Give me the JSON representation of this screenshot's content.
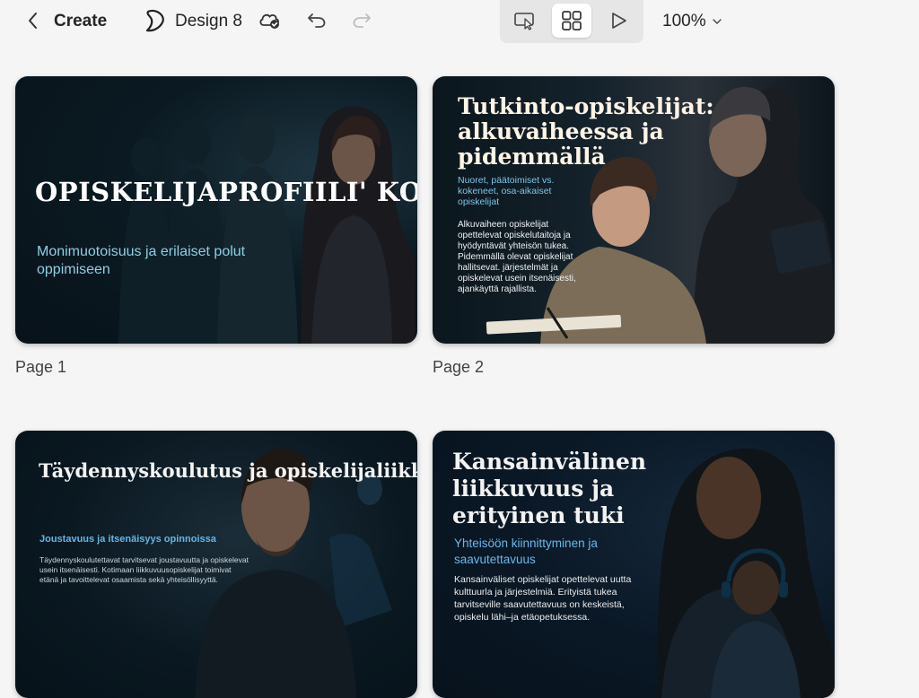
{
  "toolbar": {
    "create_label": "Create",
    "design_name": "Design 8",
    "zoom_label": "100%"
  },
  "icons": {
    "back": "chevron-left-icon",
    "logo": "design-logo-icon",
    "cloud": "cloud-saved-icon",
    "undo": "undo-icon",
    "redo": "redo-icon",
    "present_cursor": "cursor-present-icon",
    "grid": "grid-view-icon",
    "play": "play-icon",
    "zoom_chevron": "chevron-down-icon"
  },
  "colors": {
    "accent_blue": "#7fc4ea",
    "card_dark": "#0b1a22"
  },
  "pages": [
    {
      "label": "Page 1",
      "title": "OPISKELIJAPROFIILI' KORKEAKOULUISSA",
      "subtitle": "Monimuotoisuus ja erilaiset polut oppimiseen",
      "body": ""
    },
    {
      "label": "Page 2",
      "title": "Tutkinto-opiskelijat: alkuvaiheessa ja pidemmällä",
      "subtitle": "Nuoret, päätoimiset vs. kokeneet, osa-aikaiset opiskelijat",
      "body": "Alkuvaiheen opiskelijat opettelevat opiskelutaitoja ja hyödyntävät yhteisön tukea. Pidemmällä olevat opiskelijat hallitsevat. järjestelmät ja opiskelevat usein itsenäisesti, ajankäyttä rajallista."
    },
    {
      "label": "",
      "title": "Täydennyskoulutus ja opiskelijaliikkuvuus Suomessa",
      "subtitle": "Joustavuus ja itsenäisyys opinnoissa",
      "body": "Täydennyskoulutettavat tarvitsevat joustavuutta ja opiskelevat usein itsenäisesti. Kotimaan liikkuvuusopiskelijat toimivat etänä ja tavoittelevat osaamista sekä yhteisöllisyyttä."
    },
    {
      "label": "",
      "title": "Kansainvälinen liikkuvuus ja erityinen tuki",
      "subtitle": "Yhteisöön kiinnittyminen ja saavutettavuus",
      "body": "Kansainväliset opiskelijat opettelevat uutta kulttuurla ja järjestelmiä. Erityistä tukea tarvitseville saavutettavuus on keskeistä, opiskelu lähi–ja etäopetuksessa."
    }
  ]
}
